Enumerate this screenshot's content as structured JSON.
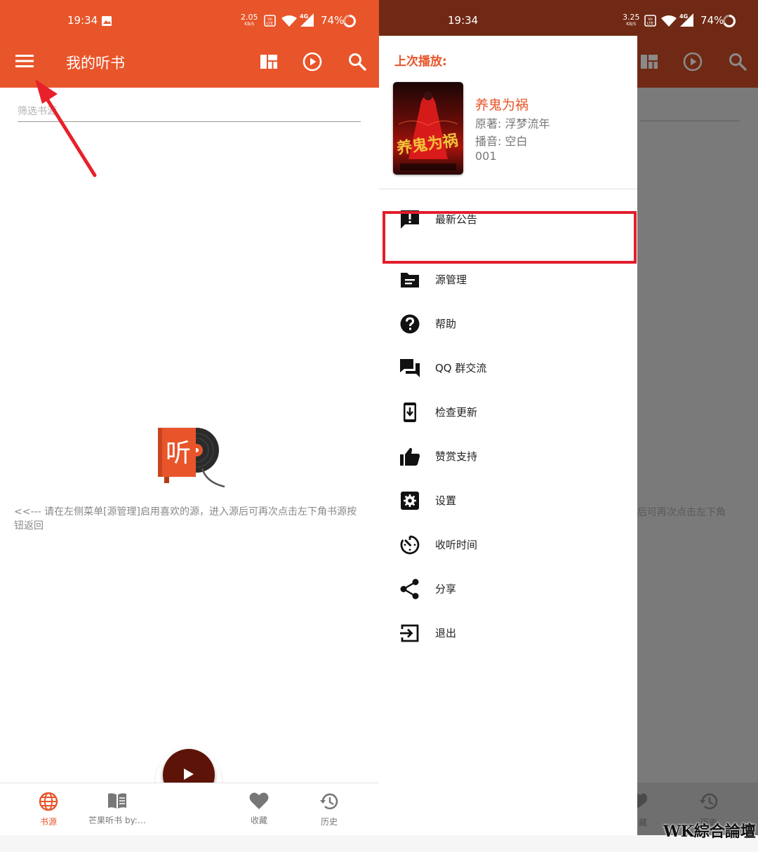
{
  "status_bar": {
    "time": "19:34",
    "left_speed": "2.05",
    "right_speed": "3.25",
    "speed_unit": "KB/S",
    "volte": "Vo LTE",
    "network": "4G",
    "battery": "74%"
  },
  "toolbar": {
    "title": "我的听书",
    "icons": [
      "menu-icon",
      "layout-icon",
      "play-circle-icon",
      "search-icon"
    ]
  },
  "filter": {
    "placeholder": "筛选书源"
  },
  "empty_hint": "<<--- 请在左侧菜单[源管理]启用喜欢的源，进入源后可再次点击左下角书源按钮返回",
  "empty_logo_text": "听",
  "bottom_nav": {
    "items": [
      {
        "label": "书源",
        "icon": "globe-icon",
        "active": true
      },
      {
        "label": "芒果听书 by:…",
        "icon": "book-icon",
        "active": false
      },
      {
        "label": "收藏",
        "icon": "heart-icon",
        "active": false
      },
      {
        "label": "历史",
        "icon": "history-icon",
        "active": false
      }
    ]
  },
  "right_dimmed": {
    "hint_fragment": "后可再次点击左下角",
    "nav_fragment_1": "藏",
    "nav_fragment_2": "历史"
  },
  "drawer": {
    "last_play_label": "上次播放:",
    "book": {
      "title": "养鬼为祸",
      "author": "原著: 浮梦流年",
      "narrator": "播音: 空白",
      "episode": "001",
      "cover_text": "养鬼为祸"
    },
    "menu": [
      {
        "label": "最新公告",
        "icon": "announcement-icon"
      },
      {
        "label": "源管理",
        "icon": "folder-icon"
      },
      {
        "label": "帮助",
        "icon": "help-icon"
      },
      {
        "label": "QQ 群交流",
        "icon": "forum-icon"
      },
      {
        "label": "检查更新",
        "icon": "system-update-icon"
      },
      {
        "label": "赞赏支持",
        "icon": "thumb-up-icon"
      },
      {
        "label": "设置",
        "icon": "settings-icon"
      },
      {
        "label": "收听时间",
        "icon": "timer-icon"
      },
      {
        "label": "分享",
        "icon": "share-icon"
      },
      {
        "label": "退出",
        "icon": "exit-icon"
      }
    ]
  },
  "colors": {
    "primary": "#e8552a",
    "primary_dark": "#702914",
    "fab": "#5c1308",
    "highlight": "#e21d2c",
    "annotation_arrow": "#e8202a"
  },
  "watermark": "WK綜合論壇"
}
